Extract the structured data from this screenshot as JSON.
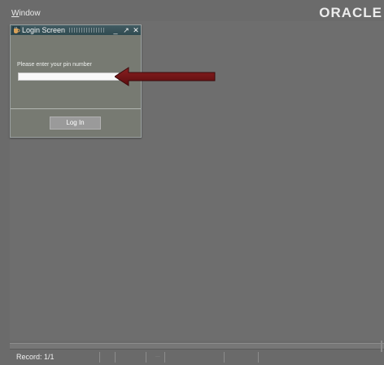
{
  "menubar": {
    "window_label_ul": "W",
    "window_label_rest": "indow"
  },
  "brand": {
    "logo_text": "ORACLE"
  },
  "dialog": {
    "title": "Login Screen",
    "prompt": "Please enter your pin number",
    "pin_value": "",
    "login_button_label": "Log In",
    "controls": {
      "minimize": "_",
      "maximize": "↗",
      "close": "✕"
    }
  },
  "status": {
    "record_text": "Record: 1/1",
    "lov_mark": "..."
  },
  "colors": {
    "background": "#6b6b6b",
    "dialog_title_bar": "#3f565c",
    "dialog_body": "#777a72",
    "arrow": "#7a1416"
  },
  "icons": {
    "app_icon": "oracle-coffee-cup-icon",
    "pointer_arrow": "left-arrow"
  }
}
